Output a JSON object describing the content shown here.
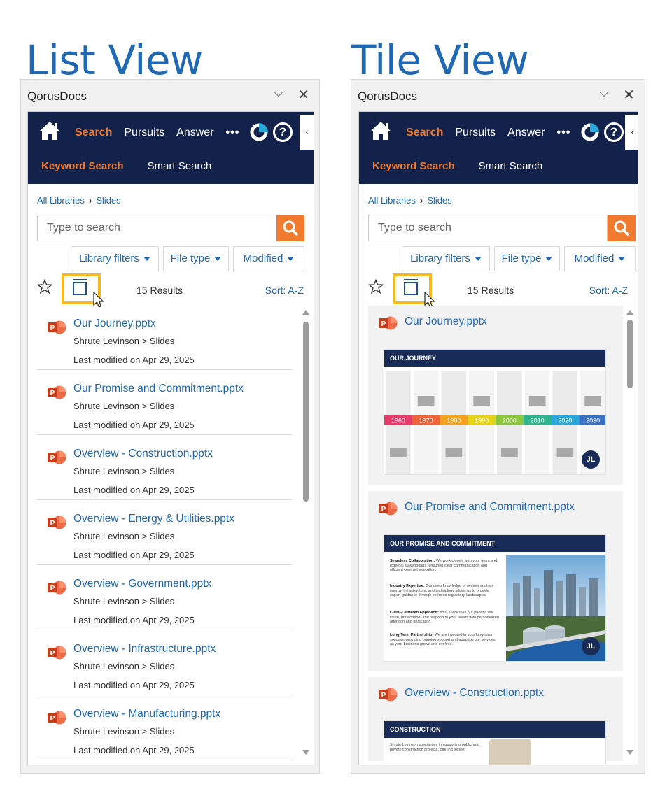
{
  "titles": {
    "list": "List View",
    "tile": "Tile View"
  },
  "panel": {
    "app_name": "QorusDocs",
    "nav_tabs": [
      "Search",
      "Pursuits",
      "Answer"
    ],
    "more_label": "•••",
    "help_label": "?",
    "collapse_label": "‹",
    "subtabs": [
      "Keyword Search",
      "Smart Search"
    ],
    "breadcrumb": [
      "All Libraries",
      "Slides"
    ],
    "search_placeholder": "Type to search",
    "filters": [
      "Library filters",
      "File type",
      "Modified"
    ],
    "results_count": "15 Results",
    "sort_label": "Sort:",
    "sort_value": "A-Z"
  },
  "list_items": [
    {
      "name": "Our Journey.pptx",
      "path": "Shrute Levinson > Slides",
      "date": "Last modified on  Apr 29, 2025"
    },
    {
      "name": "Our Promise and Commitment.pptx",
      "path": "Shrute Levinson > Slides",
      "date": "Last modified on  Apr 29, 2025"
    },
    {
      "name": "Overview - Construction.pptx",
      "path": "Shrute Levinson > Slides",
      "date": "Last modified on  Apr 29, 2025"
    },
    {
      "name": "Overview - Energy & Utilities.pptx",
      "path": "Shrute Levinson > Slides",
      "date": "Last modified on  Apr 29, 2025"
    },
    {
      "name": "Overview - Government.pptx",
      "path": "Shrute Levinson > Slides",
      "date": "Last modified on  Apr 29, 2025"
    },
    {
      "name": "Overview - Infrastructure.pptx",
      "path": "Shrute Levinson > Slides",
      "date": "Last modified on  Apr 29, 2025"
    },
    {
      "name": "Overview - Manufacturing.pptx",
      "path": "Shrute Levinson > Slides",
      "date": "Last modified on  Apr 29, 2025"
    }
  ],
  "tiles": [
    {
      "name": "Our Journey.pptx",
      "slide_title": "OUR JOURNEY",
      "years": [
        "1960",
        "1970",
        "1980",
        "1990",
        "2000",
        "2010",
        "2020",
        "2030"
      ],
      "year_colors": [
        "#e83a6b",
        "#f0623a",
        "#f5a31f",
        "#e7d21b",
        "#8cc63f",
        "#2fb58e",
        "#29a7d8",
        "#3b6fc2"
      ]
    },
    {
      "name": "Our Promise and Commitment.pptx",
      "slide_title": "OUR PROMISE AND COMMITMENT",
      "paragraphs": [
        {
          "head": "Seamless Collaboration:",
          "body": " We work closely with your team and external stakeholders, ensuring clear communication and efficient contract execution."
        },
        {
          "head": "Industry Expertise:",
          "body": " Our deep knowledge of sectors such as energy, infrastructure, and technology allows us to provide expert guidance through complex regulatory landscapes."
        },
        {
          "head": "Client-Centered Approach:",
          "body": " Your success is our priority. We listen, understand, and respond to your needs with personalized attention and dedication."
        },
        {
          "head": "Long-Term Partnership:",
          "body": " We are invested in your long-term success, providing ongoing support and adapting our services as your business grows and evolves."
        }
      ]
    },
    {
      "name": "Overview - Construction.pptx",
      "slide_title": "CONSTRUCTION",
      "snippet": "Shrute Levinson specialises in supporting public and private construction projects, offering expert"
    }
  ],
  "badge_label": "JL",
  "colors": {
    "brand_navy": "#13224b",
    "accent_orange": "#f07a2e",
    "link_blue": "#1f68b3",
    "highlight_yellow": "#f6b91b",
    "ppt_red": "#d24726"
  }
}
